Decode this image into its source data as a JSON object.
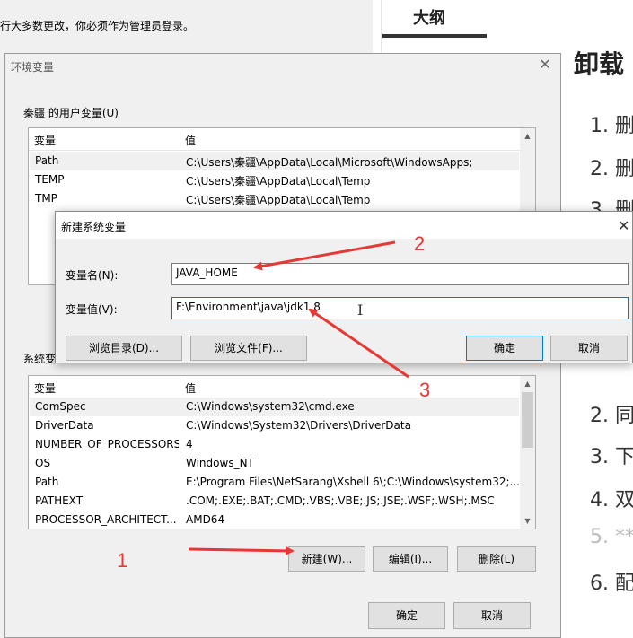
{
  "background_window": {
    "notice": "行大多数更改，你必须作为管理员登录。"
  },
  "outline_panel": {
    "title": "大纲"
  },
  "document": {
    "heading": "卸载",
    "items_top": [
      "1. 删",
      "2. 删",
      "3. 删"
    ],
    "items_bottom": [
      "2. 同",
      "3. 下",
      "4. 双",
      "5. **",
      "6. 配"
    ]
  },
  "env_dialog": {
    "title": "环境变量",
    "user_group_label": "秦疆 的用户变量(U)",
    "system_group_label": "系统变",
    "columns": [
      "变量",
      "值"
    ],
    "user_vars": [
      {
        "name": "Path",
        "value": "C:\\Users\\秦疆\\AppData\\Local\\Microsoft\\WindowsApps;"
      },
      {
        "name": "TEMP",
        "value": "C:\\Users\\秦疆\\AppData\\Local\\Temp"
      },
      {
        "name": "TMP",
        "value": "C:\\Users\\秦疆\\AppData\\Local\\Temp"
      }
    ],
    "system_vars": [
      {
        "name": "ComSpec",
        "value": "C:\\Windows\\system32\\cmd.exe"
      },
      {
        "name": "DriverData",
        "value": "C:\\Windows\\System32\\Drivers\\DriverData"
      },
      {
        "name": "NUMBER_OF_PROCESSORS",
        "value": "4"
      },
      {
        "name": "OS",
        "value": "Windows_NT"
      },
      {
        "name": "Path",
        "value": "E:\\Program Files\\NetSarang\\Xshell 6\\;C:\\Windows\\system32;..."
      },
      {
        "name": "PATHEXT",
        "value": ".COM;.EXE;.BAT;.CMD;.VBS;.VBE;.JS;.JSE;.WSF;.WSH;.MSC"
      },
      {
        "name": "PROCESSOR_ARCHITECT...",
        "value": "AMD64"
      }
    ],
    "buttons": {
      "new": "新建(W)...",
      "edit": "编辑(I)...",
      "delete": "删除(L)",
      "ok": "确定",
      "cancel": "取消"
    }
  },
  "new_var_dialog": {
    "title": "新建系统变量",
    "name_label": "变量名(N):",
    "name_value": "JAVA_HOME",
    "value_label": "变量值(V):",
    "value_value": "F:\\Environment\\java\\jdk1.8",
    "browse_dir": "浏览目录(D)...",
    "browse_file": "浏览文件(F)...",
    "ok": "确定",
    "cancel": "取消"
  },
  "annotations": [
    "1",
    "2",
    "3"
  ],
  "colors": {
    "annotation_red": "#e53935",
    "dialog_bg": "#f0f0f0",
    "accent_blue": "#0078d7"
  }
}
